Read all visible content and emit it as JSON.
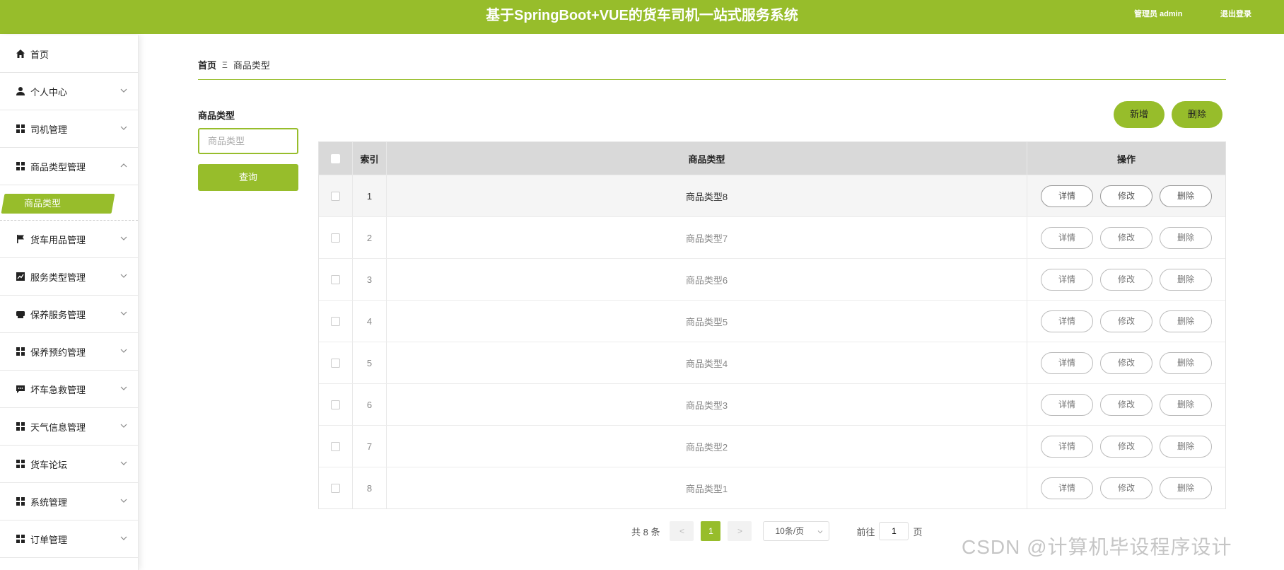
{
  "header": {
    "title": "基于SpringBoot+VUE的货车司机一站式服务系统",
    "user": "管理员 admin",
    "logout": "退出登录",
    "bg_color": "#97bd2b"
  },
  "sidebar": {
    "items": [
      {
        "label": "首页",
        "icon": "home-icon",
        "expandable": false
      },
      {
        "label": "个人中心",
        "icon": "user-icon",
        "expandable": true
      },
      {
        "label": "司机管理",
        "icon": "grid-icon",
        "expandable": true
      },
      {
        "label": "商品类型管理",
        "icon": "grid-icon",
        "expandable": true,
        "expanded": true
      },
      {
        "label": "货车用品管理",
        "icon": "flag-icon",
        "expandable": true
      },
      {
        "label": "服务类型管理",
        "icon": "chart-icon",
        "expandable": true
      },
      {
        "label": "保养服务管理",
        "icon": "printer-icon",
        "expandable": true
      },
      {
        "label": "保养预约管理",
        "icon": "grid-icon",
        "expandable": true
      },
      {
        "label": "坏车急救管理",
        "icon": "chat-icon",
        "expandable": true
      },
      {
        "label": "天气信息管理",
        "icon": "grid-icon",
        "expandable": true
      },
      {
        "label": "货车论坛",
        "icon": "grid-icon",
        "expandable": true
      },
      {
        "label": "系统管理",
        "icon": "grid-icon",
        "expandable": true
      },
      {
        "label": "订单管理",
        "icon": "grid-icon",
        "expandable": true
      }
    ],
    "active_sub": "商品类型"
  },
  "breadcrumb": {
    "home": "首页",
    "separator": "Ξ",
    "current": "商品类型"
  },
  "search": {
    "label": "商品类型",
    "placeholder": "商品类型",
    "button": "查询"
  },
  "actions": {
    "add": "新增",
    "delete": "删除"
  },
  "table": {
    "headers": {
      "index": "索引",
      "name": "商品类型",
      "ops": "操作"
    },
    "rows": [
      {
        "index": "1",
        "name": "商品类型8"
      },
      {
        "index": "2",
        "name": "商品类型7"
      },
      {
        "index": "3",
        "name": "商品类型6"
      },
      {
        "index": "4",
        "name": "商品类型5"
      },
      {
        "index": "5",
        "name": "商品类型4"
      },
      {
        "index": "6",
        "name": "商品类型3"
      },
      {
        "index": "7",
        "name": "商品类型2"
      },
      {
        "index": "8",
        "name": "商品类型1"
      }
    ],
    "ops": {
      "detail": "详情",
      "edit": "修改",
      "delete": "删除"
    }
  },
  "pagination": {
    "total": "共 8 条",
    "prev": "<",
    "page": "1",
    "next": ">",
    "page_size": "10条/页",
    "goto_label": "前往",
    "goto_value": "1",
    "goto_suffix": "页"
  },
  "watermark": "CSDN @计算机毕设程序设计"
}
